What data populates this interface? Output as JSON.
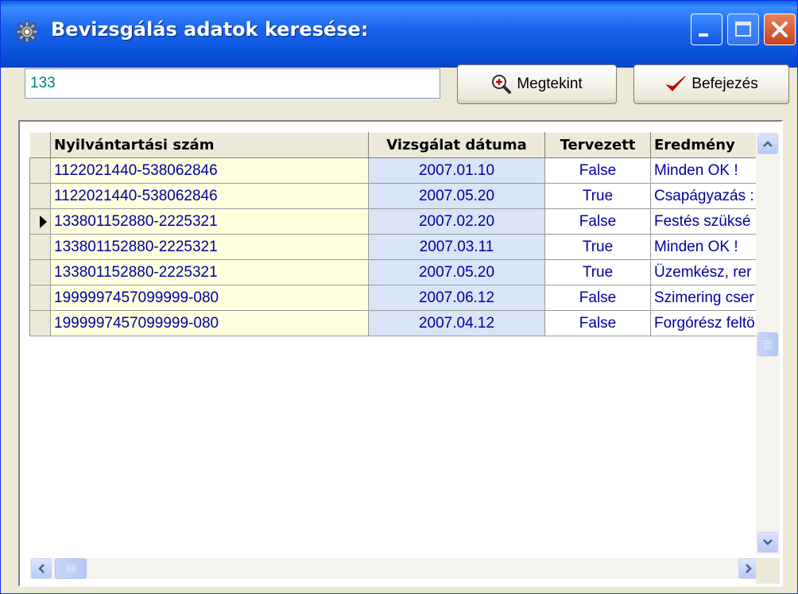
{
  "window": {
    "title": "Bevizsgálás adatok keresése:"
  },
  "search": {
    "value": "133"
  },
  "buttons": {
    "view_label": "Megtekint",
    "finish_label": "Befejezés"
  },
  "grid": {
    "columns": [
      "Nyilvántartási szám",
      "Vizsgálat dátuma",
      "Tervezett",
      "Eredmény"
    ],
    "current_row": 2,
    "rows": [
      {
        "id": "1122021440-538062846",
        "date": "2007.01.10",
        "planned": "False",
        "result": "Minden OK !"
      },
      {
        "id": "1122021440-538062846",
        "date": "2007.05.20",
        "planned": "True",
        "result": "Csapágyazás :"
      },
      {
        "id": "133801152880-2225321",
        "date": "2007.02.20",
        "planned": "False",
        "result": "Festés szüksé"
      },
      {
        "id": "133801152880-2225321",
        "date": "2007.03.11",
        "planned": "True",
        "result": "Minden OK !"
      },
      {
        "id": "133801152880-2225321",
        "date": "2007.05.20",
        "planned": "True",
        "result": "Üzemkész, rer"
      },
      {
        "id": "1999997457099999-080",
        "date": "2007.06.12",
        "planned": "False",
        "result": "Szimering cser"
      },
      {
        "id": "1999997457099999-080",
        "date": "2007.04.12",
        "planned": "False",
        "result": "Forgórész feltö"
      }
    ]
  },
  "icons": {
    "app": "gear-icon",
    "view": "magnifier-plus-icon",
    "finish": "red-checkmark-icon"
  },
  "colors": {
    "titlebar": "#0a5ee6",
    "id_column_bg": "#ffffe0",
    "date_column_bg": "#d9e4f6",
    "cell_text": "#0000a0",
    "search_text": "#008080"
  }
}
